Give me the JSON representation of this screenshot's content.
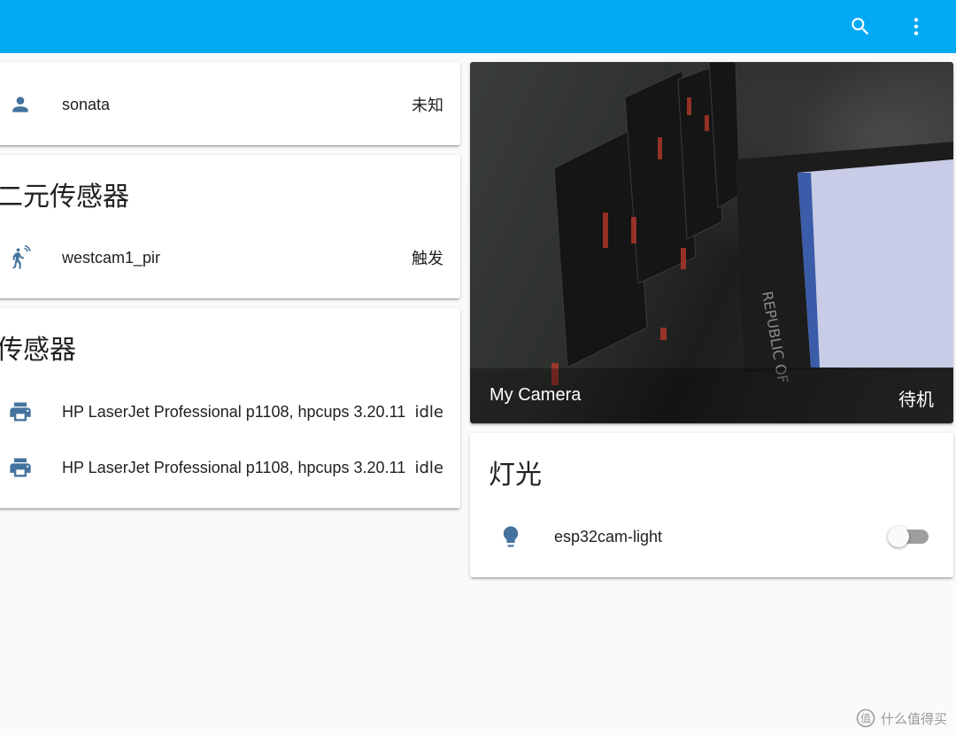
{
  "colors": {
    "toolbar": "#03a9f4",
    "icon": "#44739e",
    "background": "#fafafa"
  },
  "toolbar": {
    "search_icon": "search-icon",
    "menu_icon": "more-vert-icon"
  },
  "person_card": {
    "entity": {
      "icon": "account-icon",
      "name": "sonata",
      "state": "未知"
    }
  },
  "binary_sensor_card": {
    "title": "二元传感器",
    "entity": {
      "icon": "motion-sensor-icon",
      "name": "westcam1_pir",
      "state": "触发"
    }
  },
  "sensor_card": {
    "title": "传感器",
    "entities": [
      {
        "icon": "printer-icon",
        "name": "HP LaserJet Professional p1108, hpcups 3.20.11",
        "state": "idle"
      },
      {
        "icon": "printer-icon",
        "name": "HP LaserJet Professional p1108, hpcups 3.20.11",
        "state": "idle"
      }
    ]
  },
  "camera_card": {
    "title": "My Camera",
    "state": "待机"
  },
  "light_card": {
    "title": "灯光",
    "entity": {
      "icon": "lightbulb-icon",
      "name": "esp32cam-light",
      "on": false
    }
  },
  "watermark": {
    "text": "什么值得买"
  }
}
